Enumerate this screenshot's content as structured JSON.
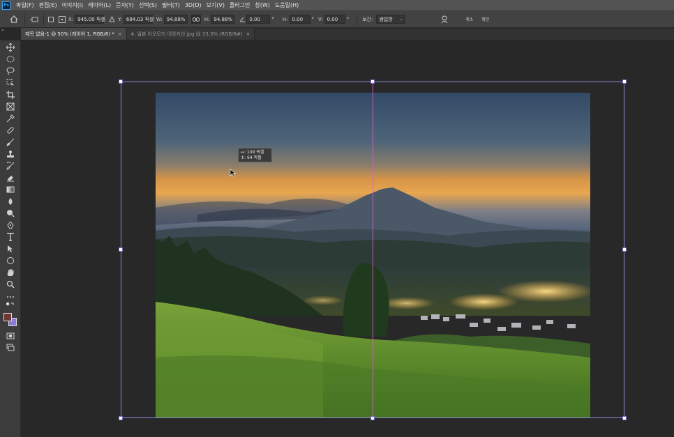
{
  "app": {
    "logo_text": "Ps",
    "menu": [
      "파일(F)",
      "편집(E)",
      "이미지(I)",
      "레이어(L)",
      "문자(Y)",
      "선택(S)",
      "필터(T)",
      "3D(D)",
      "보기(V)",
      "플러그인",
      "창(W)",
      "도움말(H)"
    ]
  },
  "options": {
    "x_label": "X:",
    "x_value": "945.00 픽셀",
    "y_label": "Y:",
    "y_value": "684.03 픽셀",
    "w_label": "W:",
    "w_value": "94.88%",
    "h_label": "H:",
    "h_value": "94.88%",
    "angle_value": "0.00",
    "angle_unit": "°",
    "hskew_label": "H:",
    "hskew_value": "0.00",
    "hskew_unit": "°",
    "vskew_label": "V:",
    "vskew_value": "0.00",
    "vskew_unit": "°",
    "interp_label": "보간:",
    "interp_value": "쌍입방",
    "cancel_label": "취소",
    "commit_label": "확인"
  },
  "tabs": [
    {
      "label": "제목 없음-1 @ 50% (레이어 1, RGB/8) *",
      "close": "×"
    },
    {
      "label": "4. 일본 아오모리 이와키산.jpg @ 33.3% (RGB/8#)",
      "close": "×"
    }
  ],
  "canvas": {
    "readout_x": "↔:  109 픽셀",
    "readout_y": "↕:   64 픽셀",
    "guide_color": "#e05bd1",
    "bbox_color": "#8f8fd8"
  },
  "colors": {
    "foreground": "#6b3a35",
    "background": "#8a7bd6"
  },
  "panel_collapse": "»"
}
